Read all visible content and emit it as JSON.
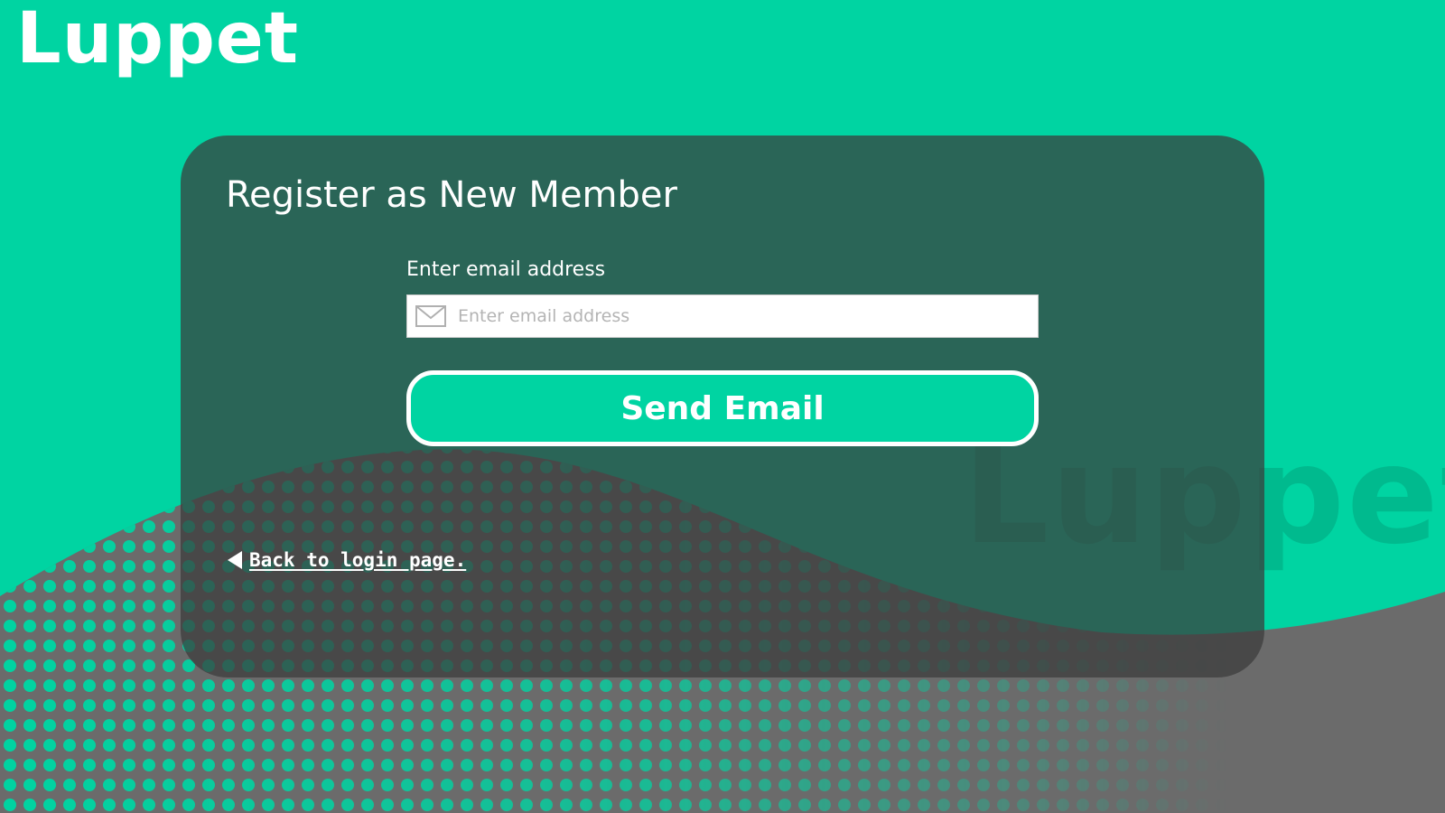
{
  "brand": {
    "logo_text": "Luppet",
    "watermark_text": "Luppet",
    "primary_color": "#00d4a2",
    "card_color": "#3a3a3a",
    "text_color": "#ffffff"
  },
  "form": {
    "title": "Register as New Member",
    "email_label": "Enter email address",
    "email_placeholder": "Enter email address",
    "email_value": "",
    "email_icon": "mail-icon",
    "submit_label": "Send Email"
  },
  "navigation": {
    "back_icon": "triangle-left-icon",
    "back_label": "Back to login page."
  }
}
